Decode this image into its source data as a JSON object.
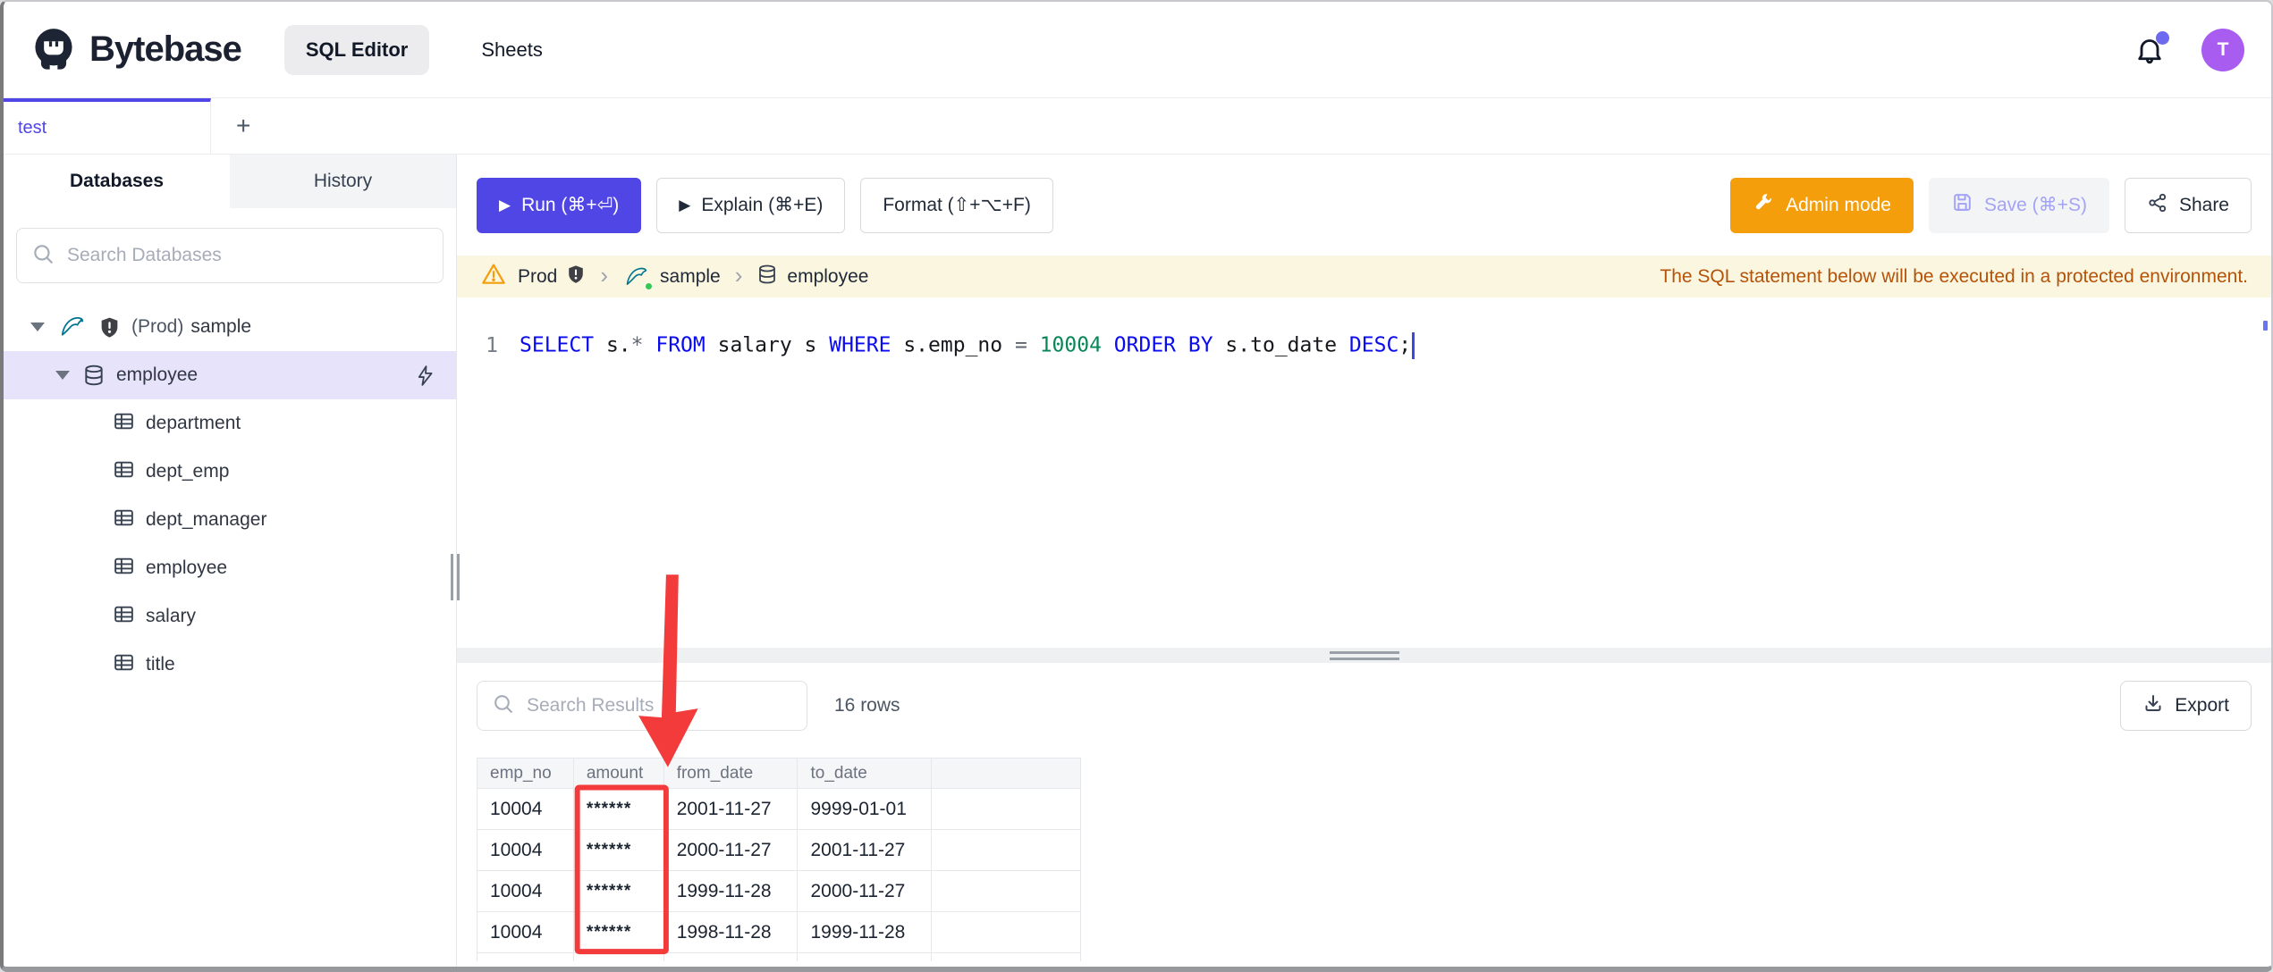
{
  "header": {
    "brand": "Bytebase",
    "nav": [
      {
        "label": "SQL Editor",
        "active": true
      },
      {
        "label": "Sheets",
        "active": false
      }
    ],
    "avatar_initial": "T"
  },
  "tab_strip": {
    "tabs": [
      {
        "label": "test",
        "active": true
      }
    ],
    "add_label": "+"
  },
  "sidebar": {
    "tabs": [
      {
        "label": "Databases",
        "active": true
      },
      {
        "label": "History",
        "active": false
      }
    ],
    "search_placeholder": "Search Databases",
    "tree": {
      "instance_env": "(Prod)",
      "instance_name": "sample",
      "database": "employee",
      "tables": [
        "department",
        "dept_emp",
        "dept_manager",
        "employee",
        "salary",
        "title"
      ]
    }
  },
  "toolbar": {
    "run_label": "Run (⌘+⏎)",
    "explain_label": "Explain (⌘+E)",
    "format_label": "Format (⇧+⌥+F)",
    "admin_label": "Admin mode",
    "save_label": "Save (⌘+S)",
    "share_label": "Share"
  },
  "breadcrumb": {
    "environment": "Prod",
    "instance": "sample",
    "database": "employee",
    "warning": "The SQL statement below will be executed in a protected environment."
  },
  "editor": {
    "line_number": "1",
    "sql": "SELECT s.* FROM salary s WHERE s.emp_no = 10004 ORDER BY s.to_date DESC;",
    "tokens": [
      {
        "text": "SELECT",
        "type": "kw"
      },
      {
        "text": " s.",
        "type": "id"
      },
      {
        "text": "*",
        "type": "op"
      },
      {
        "text": " ",
        "type": "id"
      },
      {
        "text": "FROM",
        "type": "kw"
      },
      {
        "text": " salary s ",
        "type": "id"
      },
      {
        "text": "WHERE",
        "type": "kw"
      },
      {
        "text": " s.emp_no ",
        "type": "id"
      },
      {
        "text": "=",
        "type": "op"
      },
      {
        "text": " ",
        "type": "id"
      },
      {
        "text": "10004",
        "type": "num"
      },
      {
        "text": " ",
        "type": "id"
      },
      {
        "text": "ORDER BY",
        "type": "kw"
      },
      {
        "text": " s.to_date ",
        "type": "id"
      },
      {
        "text": "DESC",
        "type": "kw"
      },
      {
        "text": ";",
        "type": "id"
      }
    ]
  },
  "results": {
    "search_placeholder": "Search Results",
    "row_count": "16 rows",
    "export_label": "Export",
    "columns": [
      "emp_no",
      "amount",
      "from_date",
      "to_date"
    ],
    "masked_column": "amount",
    "masked_value": "******",
    "rows": [
      [
        "10004",
        "******",
        "2001-11-27",
        "9999-01-01"
      ],
      [
        "10004",
        "******",
        "2000-11-27",
        "2001-11-27"
      ],
      [
        "10004",
        "******",
        "1999-11-28",
        "2000-11-27"
      ],
      [
        "10004",
        "******",
        "1998-11-28",
        "1999-11-28"
      ]
    ]
  },
  "colors": {
    "accent_indigo": "#4f46e5",
    "admin_orange": "#f59e0b",
    "warning_bg": "#fbf6e0",
    "warning_text": "#b45309",
    "annotation_red": "#f43b3b",
    "avatar_purple": "#a95cf0",
    "selected_row_bg": "#e6e3fb",
    "keyword_blue": "#0a0af0",
    "number_green": "#098658",
    "mysql_teal": "#00758f",
    "status_green": "#34c759"
  }
}
